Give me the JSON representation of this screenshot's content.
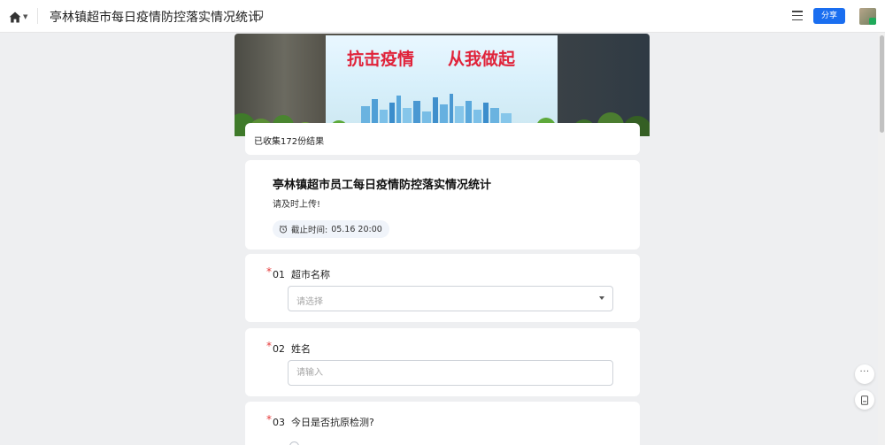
{
  "topbar": {
    "title": "亭林镇超市每日疫情防控落实情况统计",
    "share_label": "分享",
    "icons": [
      "home-icon",
      "chevron-down-icon",
      "star-icon",
      "note-icon",
      "menu-icon"
    ]
  },
  "banner": {
    "text_left": "抗击疫情",
    "text_right": "从我做起",
    "text_separator": "·"
  },
  "collection": {
    "count_text": "已收集172份结果"
  },
  "form": {
    "title": "亭林镇超市员工每日疫情防控落实情况统计",
    "description": "请及时上传!",
    "deadline_label": "截止时间:",
    "deadline_value": "05.16 20:00"
  },
  "questions": [
    {
      "required": "*",
      "number": "01",
      "label": "超市名称",
      "type": "select",
      "placeholder": "请选择"
    },
    {
      "required": "*",
      "number": "02",
      "label": "姓名",
      "type": "text",
      "placeholder": "请输入"
    },
    {
      "required": "*",
      "number": "03",
      "label": "今日是否抗原检测?",
      "type": "radio"
    }
  ],
  "side_buttons": {
    "more_label": "···",
    "icons": [
      "more-icon",
      "document-icon"
    ]
  },
  "colors": {
    "accent": "#1a6ef0",
    "required": "#e63b3b",
    "background": "#eeeff1",
    "banner_text": "#e0233a"
  }
}
